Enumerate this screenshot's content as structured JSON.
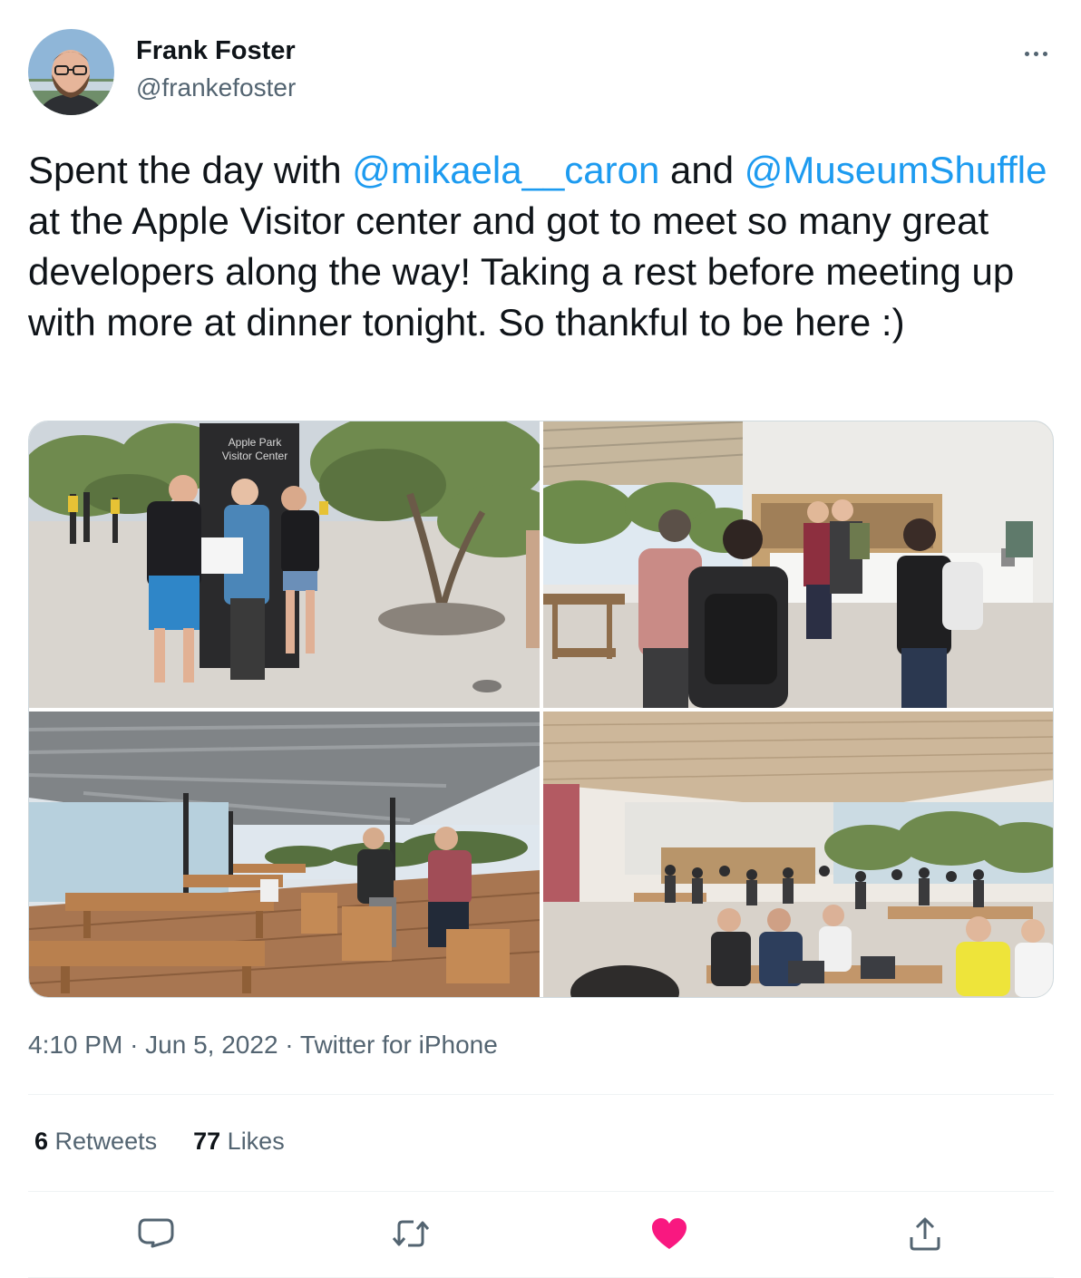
{
  "author": {
    "display_name": "Frank Foster",
    "handle": "@frankefoster",
    "avatar_icon": "avatar-photo"
  },
  "tweet": {
    "text_1": "Spent the day with ",
    "mention_1": "@mikaela__caron",
    "text_2": " and ",
    "mention_2": "@MuseumShuffle",
    "text_3": " at the Apple Visitor center and got to meet so many great developers along the way! Taking a rest before meeting up with more at dinner tonight. So thankful to be here :)"
  },
  "media": {
    "photo_1_sign": [
      "Apple Park",
      "Visitor Center"
    ]
  },
  "meta": {
    "time": "4:10 PM",
    "separator": "·",
    "date": "Jun 5, 2022",
    "source": "Twitter for iPhone"
  },
  "stats": {
    "retweets_count": "6",
    "retweets_label": "Retweets",
    "likes_count": "77",
    "likes_label": "Likes"
  },
  "colors": {
    "link": "#1d9bf0",
    "secondary_text": "#536471",
    "like_active": "#f91880"
  },
  "icons": [
    "more-icon",
    "reply-icon",
    "retweet-icon",
    "like-icon",
    "share-icon"
  ]
}
